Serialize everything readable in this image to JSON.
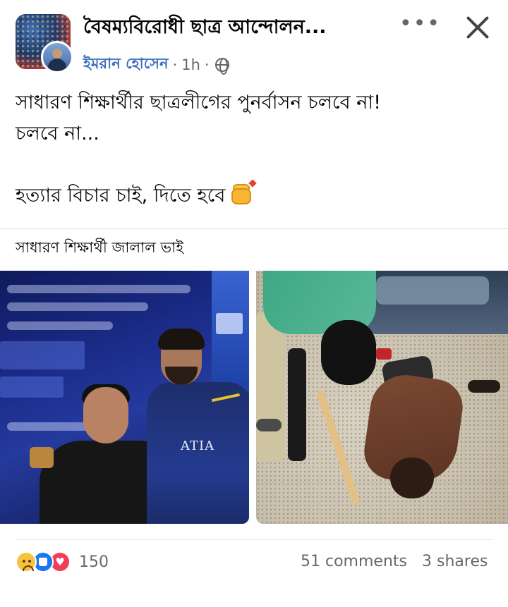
{
  "header": {
    "group_name": "বৈষম্যবিরোধী ছাত্র আন্দোলন...",
    "author": "ইমরান হোসেন",
    "time": "1h",
    "separator": "·",
    "privacy_icon": "globe-icon",
    "more_label": "•••",
    "close_icon": "close-icon"
  },
  "post": {
    "line1": "সাধারণ শিক্ষার্থীর ছাত্রলীগের পুনর্বাসন চলবে না!",
    "line2": "চলবে না...",
    "line3": "হত্যার বিচার চাই, দিতে হবে",
    "emoji_icon": "raised-fist-icon"
  },
  "caption": "সাধারণ শিক্ষার্থী জালাল ভাই",
  "photos": {
    "left_jersey_text": "ATIA"
  },
  "footer": {
    "reaction_icons": [
      "sad-icon",
      "like-icon",
      "love-icon"
    ],
    "reaction_count": "150",
    "comments": "51 comments",
    "shares": "3 shares"
  },
  "colors": {
    "author": "#3a6fbf",
    "secondary_text": "#65676b",
    "like": "#1877f2",
    "love": "#f33e58",
    "sad": "#f7c23e"
  }
}
